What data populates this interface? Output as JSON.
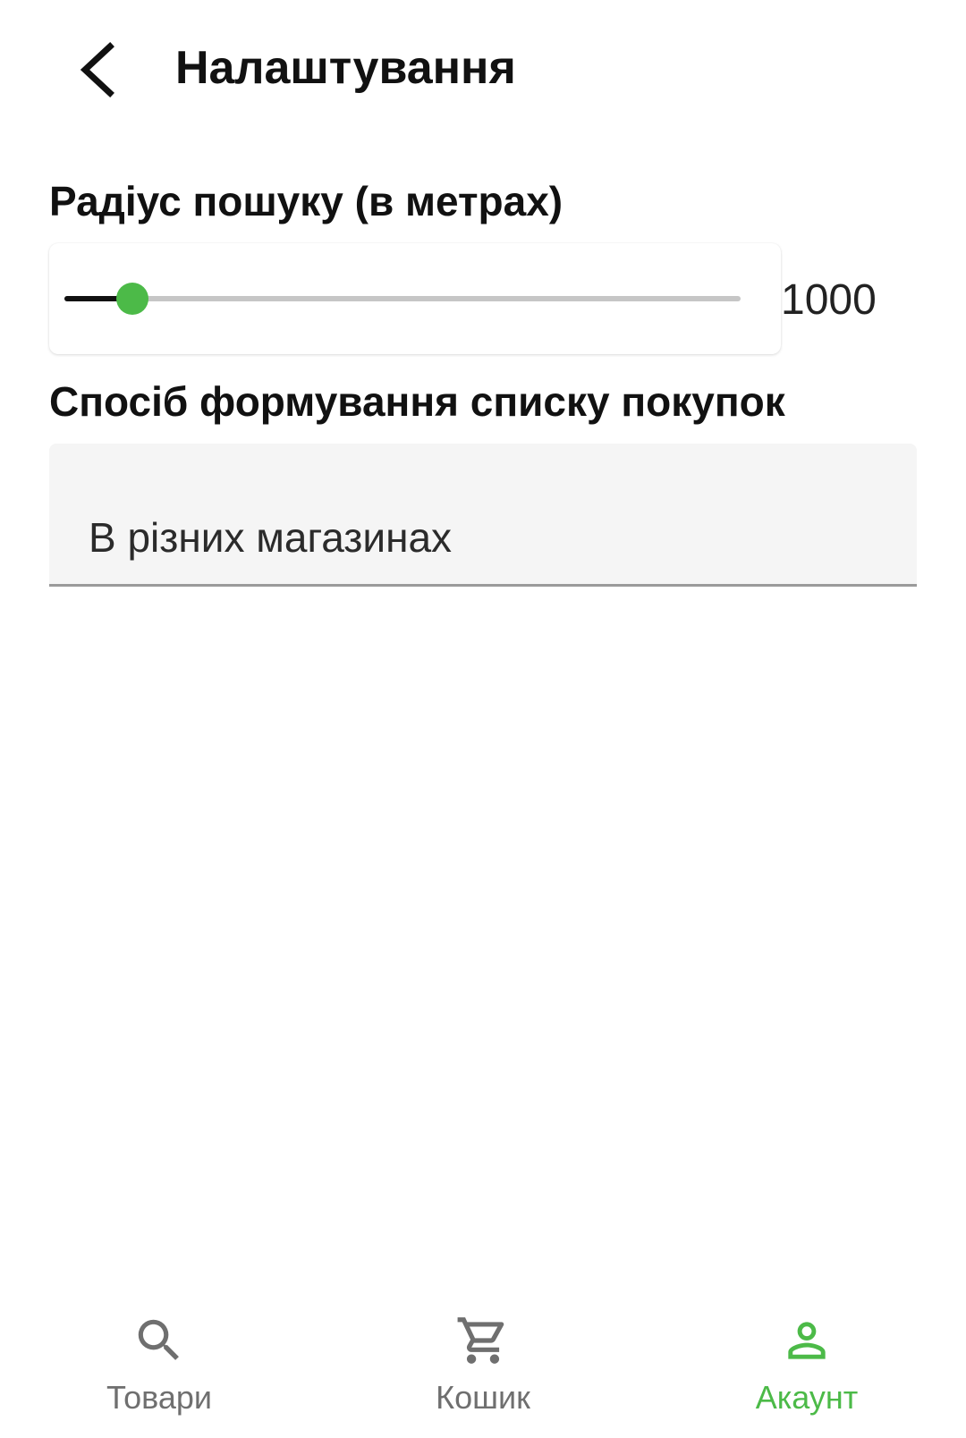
{
  "app_bar": {
    "title": "Налаштування",
    "back_icon": "chevron-left-icon"
  },
  "radius": {
    "label": "Радіус пошуку (в метрах)",
    "value": "1000",
    "slider_fraction": 0.1,
    "colors": {
      "thumb": "#4cba48",
      "active_track": "#111111",
      "inactive_track": "#c6c6c6"
    }
  },
  "shopping_mode": {
    "label": "Спосіб формування списку покупок",
    "selected": "В різних магазинах"
  },
  "bottom_nav": {
    "active_color": "#4cba48",
    "inactive_color": "#6f6f6f",
    "items": [
      {
        "label": "Товари",
        "icon": "search-icon",
        "active": false
      },
      {
        "label": "Кошик",
        "icon": "cart-icon",
        "active": false
      },
      {
        "label": "Акаунт",
        "icon": "person-icon",
        "active": true
      }
    ]
  }
}
